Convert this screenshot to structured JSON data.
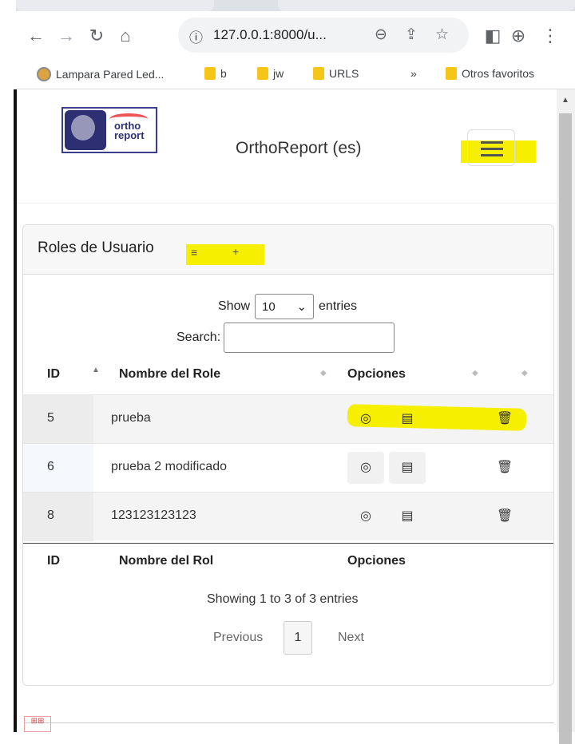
{
  "browser": {
    "url": "127.0.0.1:8000/u...",
    "bookmarks": [
      {
        "label": "Lampara Pared Led..."
      },
      {
        "label": "b"
      },
      {
        "label": "jw"
      },
      {
        "label": "URLS"
      }
    ],
    "more_bookmarks": "»",
    "other_favorites": "Otros favoritos"
  },
  "navbar": {
    "brand": "OrthoReport (es)",
    "logo_text": "ortho report"
  },
  "card": {
    "title": "Roles de Usuario",
    "list_icon": "≡",
    "add_icon": "+"
  },
  "datatable": {
    "show_label": "Show",
    "page_length": "10",
    "entries_label": "entries",
    "search_label": "Search:",
    "columns": [
      "ID",
      "Nombre del Role",
      "Opciones"
    ],
    "footer_columns": [
      "ID",
      "Nombre del Rol",
      "Opciones"
    ],
    "rows": [
      {
        "id": "5",
        "name": "prueba"
      },
      {
        "id": "6",
        "name": "prueba 2 modificado"
      },
      {
        "id": "8",
        "name": "123123123123"
      }
    ],
    "info": "Showing 1 to 3 of 3 entries",
    "previous": "Previous",
    "current_page": "1",
    "next": "Next"
  },
  "icons": {
    "view": "eye-icon",
    "edit": "form-icon",
    "delete": "trash-icon"
  },
  "colors": {
    "highlight": "#f6f000",
    "header_bg": "#f7f7f7"
  }
}
